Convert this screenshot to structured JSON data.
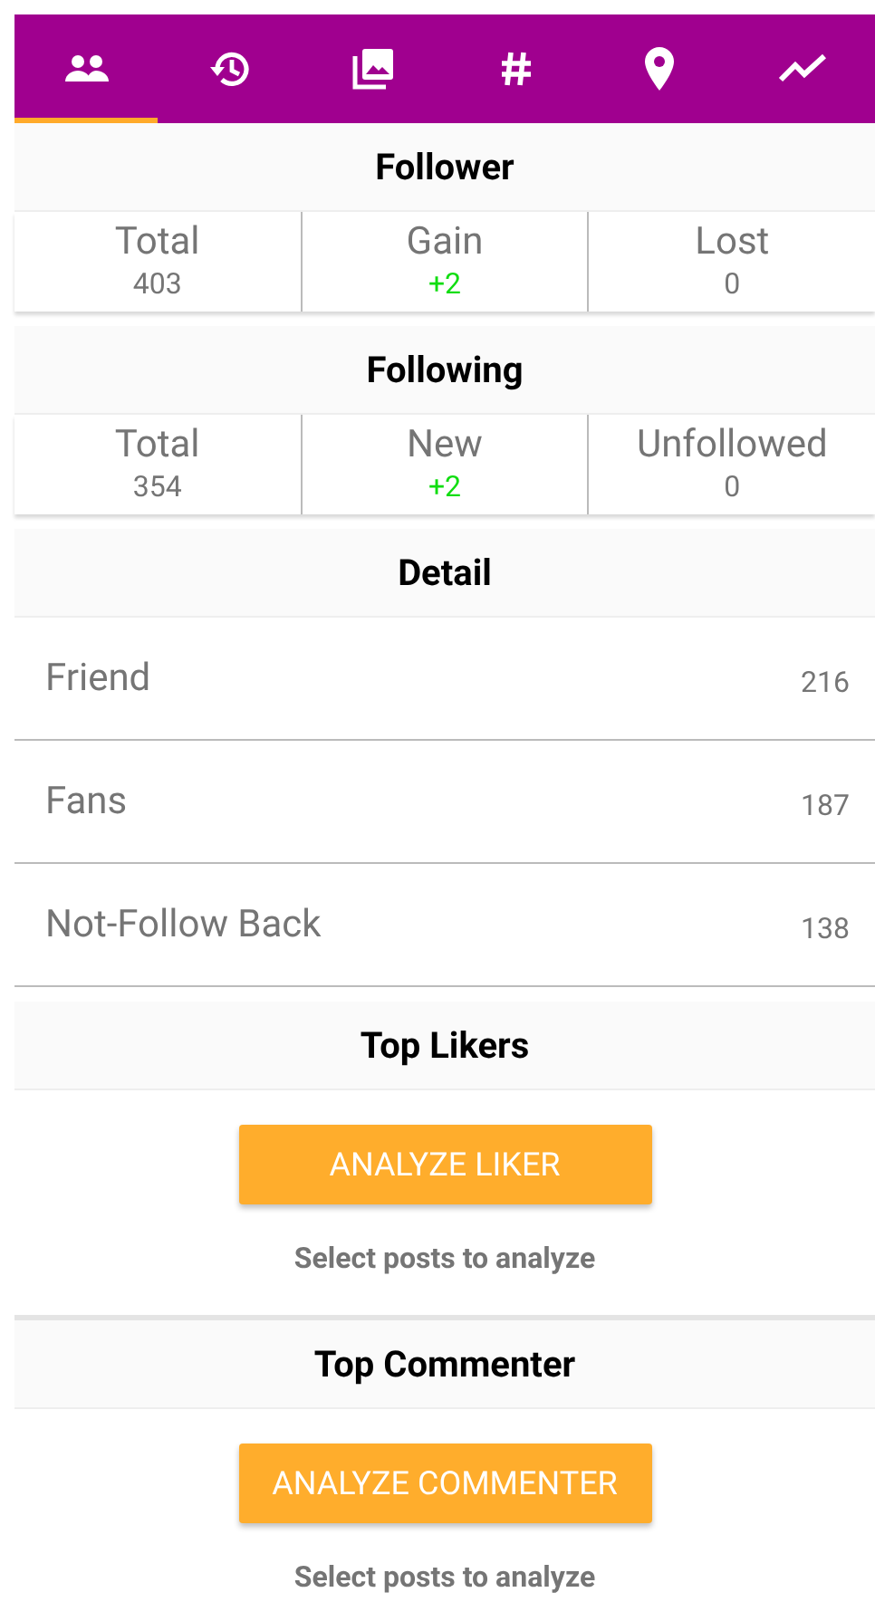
{
  "tabs": [
    {
      "selected": true
    },
    {
      "selected": false
    },
    {
      "selected": false
    },
    {
      "selected": false
    },
    {
      "selected": false
    },
    {
      "selected": false
    }
  ],
  "sections": [
    {
      "kind": "stats",
      "title": "Follower",
      "stats": [
        {
          "label": "Total",
          "value": "403",
          "highlight": false
        },
        {
          "label": "Gain",
          "value": "+2",
          "highlight": true
        },
        {
          "label": "Lost",
          "value": "0",
          "highlight": false
        }
      ]
    },
    {
      "kind": "stats",
      "title": "Following",
      "stats": [
        {
          "label": "Total",
          "value": "354",
          "highlight": false
        },
        {
          "label": "New",
          "value": "+2",
          "highlight": true
        },
        {
          "label": "Unfollowed",
          "value": "0",
          "highlight": false
        }
      ]
    },
    {
      "kind": "list",
      "title": "Detail",
      "rows": [
        {
          "label": "Friend",
          "count": "216"
        },
        {
          "label": "Fans",
          "count": "187"
        },
        {
          "label": "Not-Follow Back",
          "count": "138"
        }
      ]
    },
    {
      "kind": "analyze",
      "title": "Top Likers",
      "button": "ANALYZE LIKER",
      "hint": "Select posts to analyze"
    },
    {
      "kind": "analyze",
      "title": "Top Commenter",
      "button": "ANALYZE COMMENTER",
      "hint": "Select posts to analyze"
    }
  ]
}
